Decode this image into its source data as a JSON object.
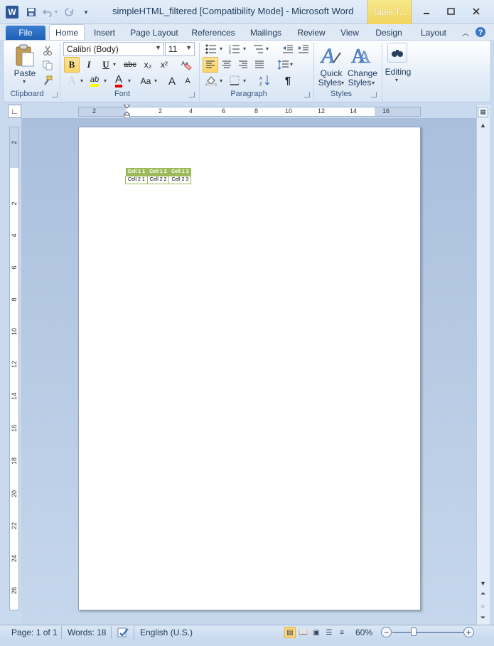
{
  "window": {
    "title": "simpleHTML_filtered [Compatibility Mode]  -  Microsoft Word",
    "contextual_tab": "Table T...",
    "app_icon_letter": "W"
  },
  "tabs": [
    "File",
    "Home",
    "Insert",
    "Page Layout",
    "References",
    "Mailings",
    "Review",
    "View",
    "Design",
    "Layout"
  ],
  "ribbon": {
    "clipboard": {
      "label": "Clipboard",
      "paste_label": "Paste"
    },
    "font": {
      "label": "Font",
      "font_name": "Calibri (Body)",
      "font_size": "11",
      "bold": "B",
      "italic": "I",
      "underline": "U",
      "strike": "abc",
      "subscript": "x₂",
      "superscript": "x²",
      "grow": "A",
      "shrink": "A",
      "case": "Aa",
      "highlight": "ab",
      "fontcolor": "A"
    },
    "paragraph": {
      "label": "Paragraph",
      "pilcrow": "¶"
    },
    "styles": {
      "label": "Styles",
      "quick_label_1": "Quick",
      "quick_label_2": "Styles",
      "change_label_1": "Change",
      "change_label_2": "Styles"
    },
    "editing": {
      "label": "Editing"
    }
  },
  "ruler": {
    "h_numbers": [
      "2",
      "2",
      "4",
      "6",
      "8",
      "10",
      "12",
      "14",
      "16"
    ],
    "v_numbers": [
      "2",
      "2",
      "4",
      "6",
      "8",
      "10",
      "12",
      "14",
      "16",
      "18",
      "20",
      "22",
      "24",
      "26"
    ]
  },
  "document": {
    "table": {
      "header": [
        "Cell 1 1",
        "Cell 1 2",
        "Cell 1 3"
      ],
      "rows": [
        [
          "Cell 2 1",
          "Cell 2 2",
          "Cell 2 3"
        ]
      ]
    }
  },
  "status": {
    "page": "Page: 1 of 1",
    "words": "Words: 18",
    "language": "English (U.S.)",
    "zoom": "60%"
  },
  "colors": {
    "accent": "#2b5797",
    "table_header": "#9bbb59",
    "contextual_tab": "#f3d45c"
  }
}
